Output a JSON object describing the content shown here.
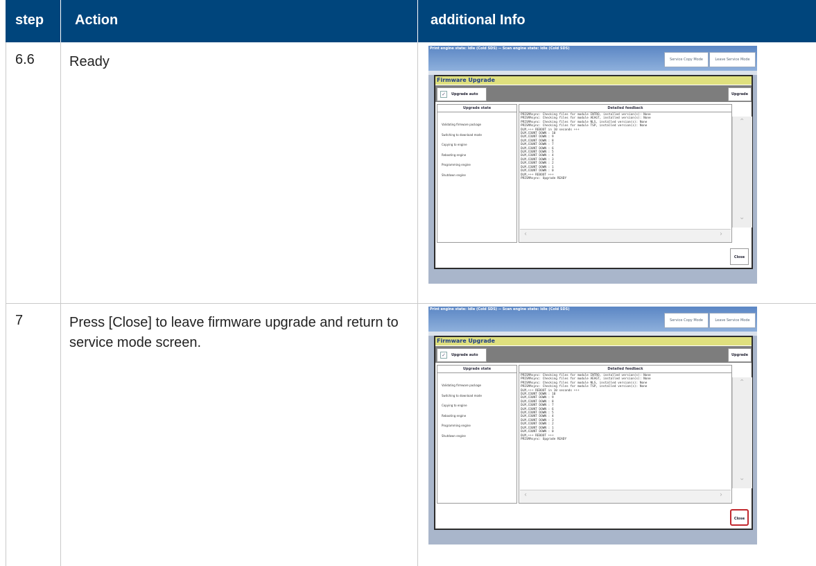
{
  "table": {
    "headers": {
      "step": "step",
      "action": "Action",
      "info": "additional Info"
    },
    "rows": [
      {
        "step": "6.6",
        "action": "Ready"
      },
      {
        "step": "7",
        "action": "Press [Close] to leave firmware upgrade and return to service mode screen."
      }
    ]
  },
  "colors": {
    "header_bg": "#00457c",
    "highlight": "#c1272d"
  },
  "screenshot": {
    "state_text": "Print engine state: Idle (Cold SDS) -- Scan engine state: Idle (Cold SDS)",
    "service_copy_mode": "Service Copy Mode",
    "leave_service_mode": "Leave Service Mode",
    "window_title": "Firmware Upgrade",
    "upgrade_auto": "Upgrade auto",
    "upgrade_button": "Upgrade",
    "upgrade_state_header": "Upgrade state",
    "detailed_feedback_header": "Detailed feedback",
    "states": [
      "Validating firmware package",
      "Switching to download mode",
      "Copying to engine",
      "Rebooting engine",
      "Programming engine",
      "Shutdown engine"
    ],
    "log": [
      "PRISMAsync: Checking files for module INTRO, installed version(s): None",
      "PRISMAsync: Checking files for module AEAGT, installed version(s): None",
      "PRISMAsync: Checking files for module NLS, installed version(s): None",
      "PRISMAsync: Checking files for module TSP, installed version(s): None",
      "DLM,+++ REBOOT in 10 seconds +++",
      "DLM,COUNT DOWN : 10",
      "DLM,COUNT DOWN : 9",
      "DLM,COUNT DOWN : 8",
      "DLM,COUNT DOWN : 7",
      "DLM,COUNT DOWN : 6",
      "DLM,COUNT DOWN : 5",
      "DLM,COUNT DOWN : 4",
      "DLM,COUNT DOWN : 3",
      "DLM,COUNT DOWN : 2",
      "DLM,COUNT DOWN : 1",
      "DLM,COUNT DOWN : 0",
      "DLM,+++ REBOOT +++",
      "PRISMAsync: Upgrade READY"
    ],
    "close_button": "Close"
  }
}
